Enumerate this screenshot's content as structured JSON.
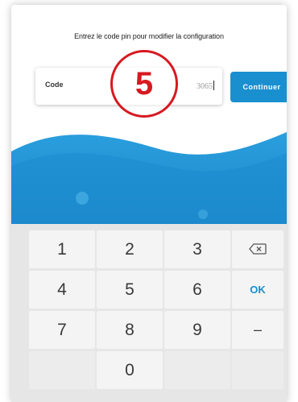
{
  "prompt": "Entrez le code pin pour modifier la configuration",
  "code": {
    "label": "Code",
    "value": "3065"
  },
  "continue_label": "Continuer",
  "step_badge": "5",
  "keypad": {
    "row1": [
      "1",
      "2",
      "3"
    ],
    "row2": [
      "4",
      "5",
      "6"
    ],
    "row3": [
      "7",
      "8",
      "9"
    ],
    "ok_label": "OK",
    "minus_label": "–",
    "zero_label": "0",
    "backspace_icon": "backspace-icon"
  },
  "colors": {
    "accent": "#1a8fd0",
    "badge": "#d71920",
    "keypad_bg": "#e6e6e6"
  }
}
